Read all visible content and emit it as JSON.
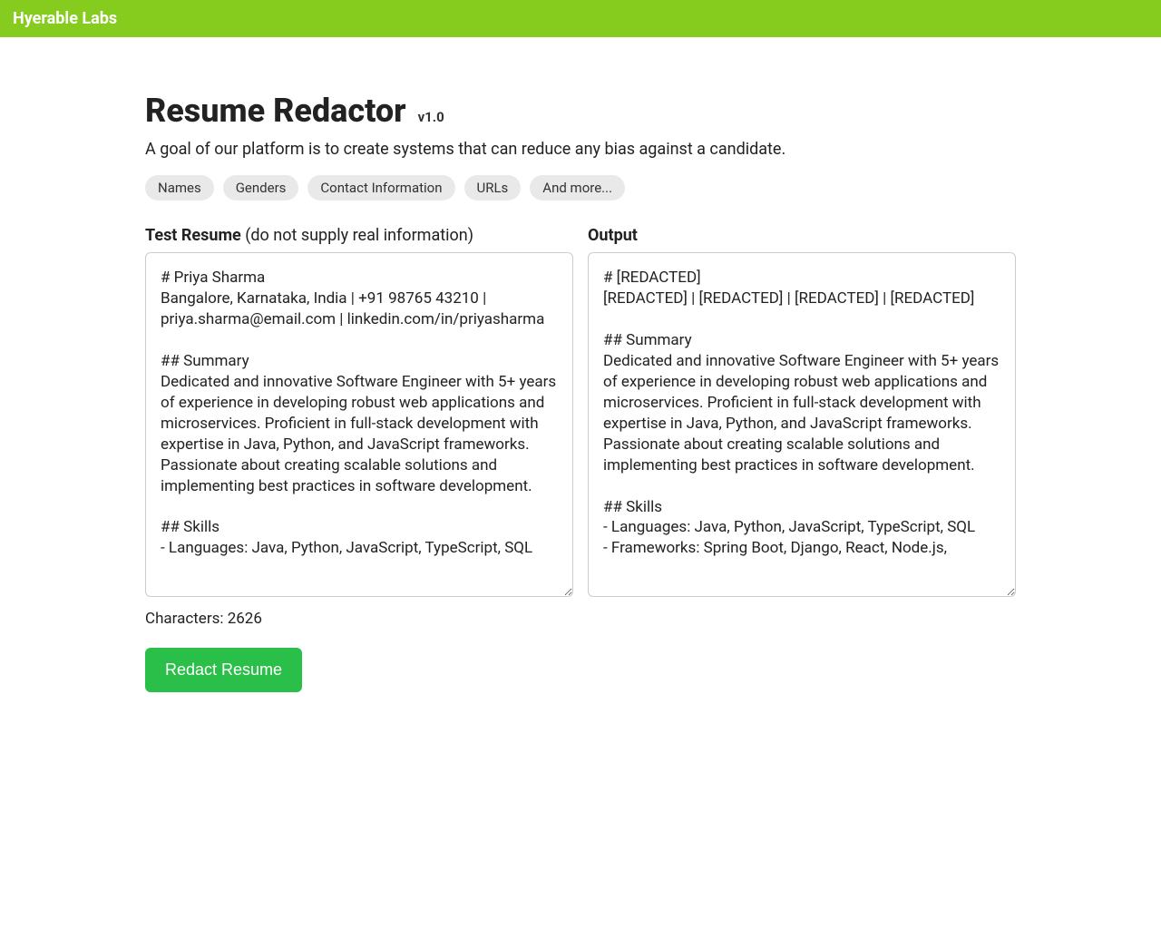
{
  "topbar": {
    "brand": "Hyerable Labs"
  },
  "header": {
    "title": "Resume Redactor",
    "version": "v1.0",
    "subtitle": "A goal of our platform is to create systems that can reduce any bias against a candidate."
  },
  "chips": [
    "Names",
    "Genders",
    "Contact Information",
    "URLs",
    "And more..."
  ],
  "labels": {
    "test_resume_bold": "Test Resume",
    "test_resume_hint": " (do not supply real information)",
    "output": "Output",
    "characters_prefix": "Characters: ",
    "characters_value": "2626",
    "redact_button": "Redact Resume"
  },
  "input_resume": "# Priya Sharma\nBangalore, Karnataka, India | +91 98765 43210 | priya.sharma@email.com | linkedin.com/in/priyasharma\n\n## Summary\nDedicated and innovative Software Engineer with 5+ years of experience in developing robust web applications and microservices. Proficient in full-stack development with expertise in Java, Python, and JavaScript frameworks. Passionate about creating scalable solutions and implementing best practices in software development.\n\n## Skills\n- Languages: Java, Python, JavaScript, TypeScript, SQL",
  "output_resume": "# [REDACTED]\n[REDACTED] | [REDACTED] | [REDACTED] | [REDACTED]\n\n## Summary\nDedicated and innovative Software Engineer with 5+ years of experience in developing robust web applications and microservices. Proficient in full-stack development with expertise in Java, Python, and JavaScript frameworks. Passionate about creating scalable solutions and implementing best practices in software development.\n\n## Skills\n- Languages: Java, Python, JavaScript, TypeScript, SQL\n- Frameworks: Spring Boot, Django, React, Node.js,"
}
